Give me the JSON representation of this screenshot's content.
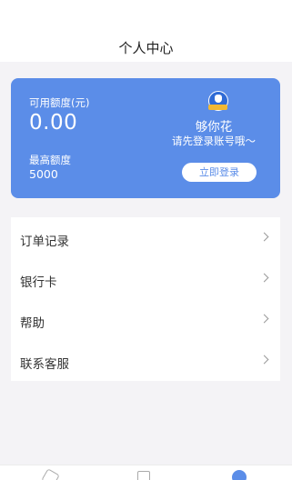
{
  "header": {
    "title": "个人中心"
  },
  "card": {
    "available_label": "可用额度(元)",
    "available_value": "0.00",
    "max_label": "最高额度",
    "max_value": "5000",
    "app_name": "够你花",
    "prompt": "请先登录账号哦～",
    "login_label": "立即登录",
    "logo_icon": "money-bag-icon",
    "accent_color": "#5b8de8"
  },
  "menu": {
    "items": [
      {
        "label": "订单记录"
      },
      {
        "label": "银行卡"
      },
      {
        "label": "帮助"
      },
      {
        "label": "联系客服"
      }
    ]
  },
  "tabbar": {
    "tabs": [
      {
        "icon": "home-icon",
        "active": false
      },
      {
        "icon": "document-icon",
        "active": false
      },
      {
        "icon": "profile-icon",
        "active": true
      }
    ]
  }
}
